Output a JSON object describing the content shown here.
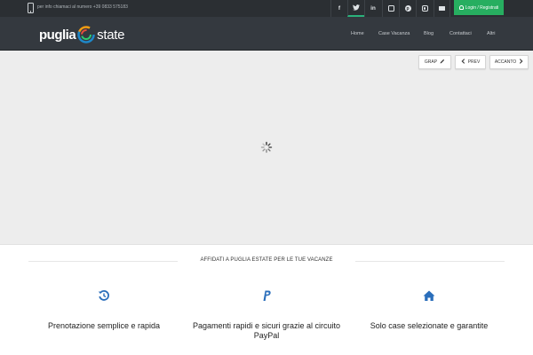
{
  "topbar": {
    "info_text": "per info chiamaci al numero +39 0833 575183",
    "social_icons": [
      "facebook-icon",
      "twitter-icon",
      "linkedin-icon",
      "instagram-box-icon",
      "pinterest-icon",
      "instagram-icon",
      "email-icon"
    ],
    "login_label": "Login / Registrati",
    "accent_color": "#27ae60"
  },
  "header": {
    "logo_word1": "puglia",
    "logo_word2": "state",
    "nav": [
      "Home",
      "Case Vacanza",
      "Blog",
      "Contattaci",
      "Altri"
    ]
  },
  "gallery": {
    "grid_label": "GRAP",
    "prev_label": "PREV",
    "next_label": "ACCANTO"
  },
  "features": {
    "title": "AFFIDATI A PUGLIA ESTATE PER LE TUE VACANZE",
    "items": [
      {
        "icon": "history-icon",
        "text": "Prenotazione semplice e rapida"
      },
      {
        "icon": "paypal-icon",
        "text": "Pagamenti rapidi e sicuri grazie al circuito PayPal"
      },
      {
        "icon": "home-icon",
        "text": "Solo case selezionate e garantite"
      }
    ],
    "icon_color": "#2a6ebb"
  }
}
